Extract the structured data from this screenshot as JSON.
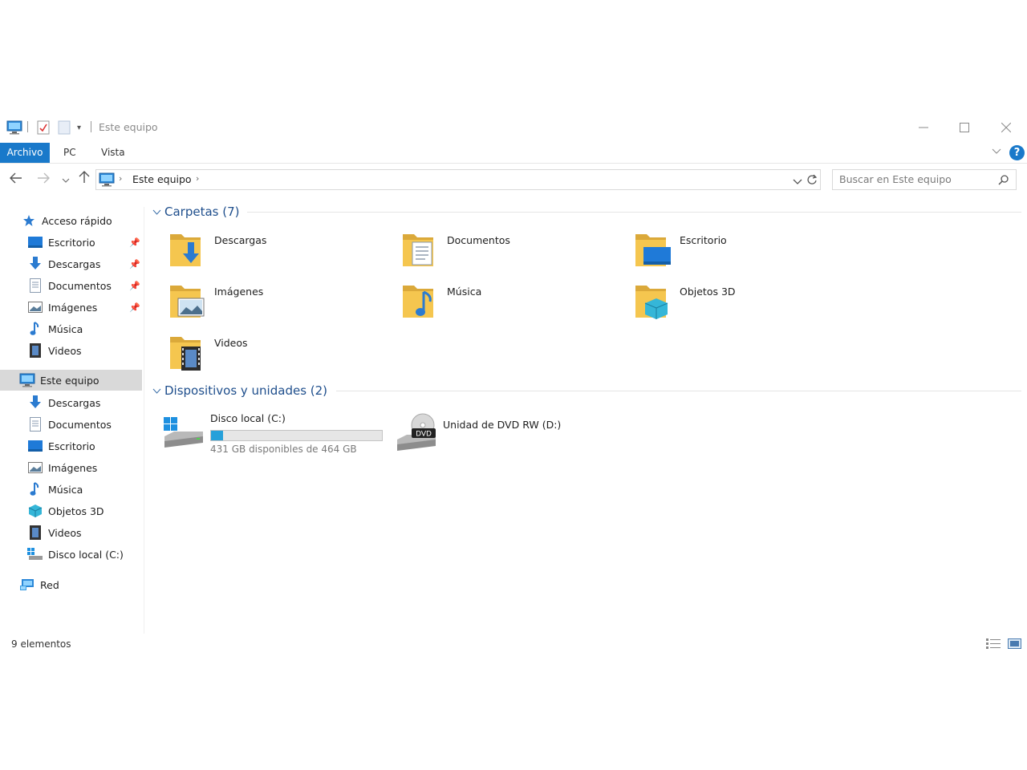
{
  "window": {
    "title": "Este equipo"
  },
  "ribbon": {
    "tabs": [
      "Archivo",
      "PC",
      "Vista"
    ],
    "help": "?"
  },
  "address": {
    "crumb": "Este equipo",
    "search_placeholder": "Buscar en Este equipo"
  },
  "nav": {
    "quick_access": "Acceso rápido",
    "quick_items": [
      {
        "label": "Escritorio",
        "icon": "desktop-icon",
        "pinned": true
      },
      {
        "label": "Descargas",
        "icon": "downloads-icon",
        "pinned": true
      },
      {
        "label": "Documentos",
        "icon": "documents-icon",
        "pinned": true
      },
      {
        "label": "Imágenes",
        "icon": "pictures-icon",
        "pinned": true
      },
      {
        "label": "Música",
        "icon": "music-icon",
        "pinned": false
      },
      {
        "label": "Videos",
        "icon": "videos-icon",
        "pinned": false
      }
    ],
    "this_pc": "Este equipo",
    "pc_items": [
      {
        "label": "Descargas",
        "icon": "downloads-icon"
      },
      {
        "label": "Documentos",
        "icon": "documents-icon"
      },
      {
        "label": "Escritorio",
        "icon": "desktop-icon"
      },
      {
        "label": "Imágenes",
        "icon": "pictures-icon"
      },
      {
        "label": "Música",
        "icon": "music-icon"
      },
      {
        "label": "Objetos 3D",
        "icon": "objects3d-icon"
      },
      {
        "label": "Videos",
        "icon": "videos-icon"
      },
      {
        "label": "Disco local (C:)",
        "icon": "local-disk-icon"
      }
    ],
    "network": "Red"
  },
  "content": {
    "folders_header": "Carpetas (7)",
    "folders": [
      {
        "label": "Descargas",
        "icon": "downloads-folder-icon"
      },
      {
        "label": "Documentos",
        "icon": "documents-folder-icon"
      },
      {
        "label": "Escritorio",
        "icon": "desktop-folder-icon"
      },
      {
        "label": "Imágenes",
        "icon": "pictures-folder-icon"
      },
      {
        "label": "Música",
        "icon": "music-folder-icon"
      },
      {
        "label": "Objetos 3D",
        "icon": "objects3d-folder-icon"
      },
      {
        "label": "Videos",
        "icon": "videos-folder-icon"
      }
    ],
    "devices_header": "Dispositivos y unidades (2)",
    "devices": [
      {
        "label": "Disco local (C:)",
        "free_text": "431 GB disponibles de 464 GB",
        "used_fraction": 0.071,
        "icon": "windows-drive-icon"
      },
      {
        "label": "Unidad de DVD RW (D:)",
        "icon": "dvd-drive-icon",
        "badge": "DVD"
      }
    ]
  },
  "status": {
    "count": "9 elementos"
  },
  "colors": {
    "accent": "#1979ca",
    "group_title": "#1e4e8c",
    "drive_fill": "#26a0da",
    "folder": "#f5c64f"
  }
}
